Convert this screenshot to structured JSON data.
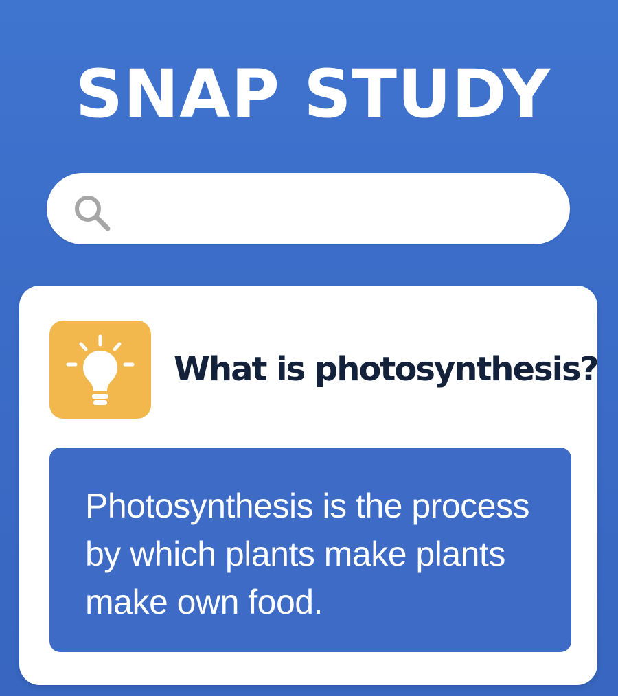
{
  "app": {
    "title": "SNAP STUDY"
  },
  "search": {
    "icon": "search-icon",
    "value": "",
    "placeholder": ""
  },
  "card": {
    "icon": "lightbulb-icon",
    "question": "What is photosynthesis?",
    "answer": "Photosynthesis is the process by which plants make plants make own food."
  },
  "colors": {
    "background": "#3a6bc6",
    "card": "#ffffff",
    "icon_tile": "#f2b84d",
    "answer_box": "#3d6bc6",
    "question_text": "#13213b",
    "search_icon": "#a6a6a6"
  }
}
